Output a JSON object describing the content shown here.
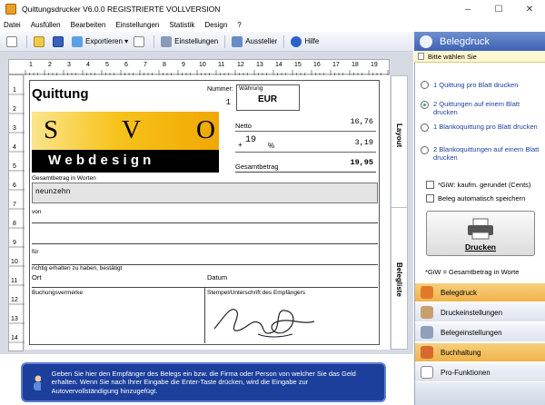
{
  "window": {
    "title": "Quittungsdrucker V6.0.0   REGISTRIERTE VOLLVERSION",
    "controls": [
      "–",
      "☐",
      "✕"
    ]
  },
  "menu": [
    "Datei",
    "Ausfüllen",
    "Bearbeiten",
    "Einstellungen",
    "Statistik",
    "Design",
    "?"
  ],
  "toolbar": {
    "export": "Exportieren ▾",
    "settings": "Einstellungen",
    "issuer": "Aussteller",
    "help": "Hilfe"
  },
  "ruler": {
    "top": [
      "1",
      "2",
      "3",
      "4",
      "5",
      "6",
      "7",
      "8",
      "9",
      "10",
      "11",
      "12",
      "13",
      "14",
      "15",
      "16",
      "17",
      "18",
      "19"
    ],
    "left": [
      "1",
      "2",
      "3",
      "4",
      "5",
      "6",
      "7",
      "8",
      "9",
      "10",
      "11",
      "12",
      "13",
      "14"
    ]
  },
  "receipt": {
    "title": "Quittung",
    "number_label": "Nummer:",
    "number_value": "1",
    "currency_label": "Währung",
    "currency_value": "EUR",
    "logo_letters": [
      "S",
      "V",
      "O"
    ],
    "logo_subtitle": "W e b d e s i g n",
    "net_label": "Netto",
    "net_value": "16,76",
    "tax_sign": "+",
    "tax_rate": "19",
    "tax_unit": "%",
    "tax_value": "3,19",
    "total_label": "Gesamtbetrag",
    "total_value": "19,95",
    "amount_words_label": "Gesamtbetrag in Worten",
    "amount_words_value": "neunzehn",
    "from_label": "von",
    "for_label": "für",
    "confirm_label": "richtig erhalten zu haben, bestätigt",
    "place_label": "Ort",
    "date_label": "Datum",
    "notes_label": "Buchungsvermerke",
    "signature_label": "Stempel/Unterschrift des Empfängers"
  },
  "side_tabs": {
    "layout": "Layout",
    "list": "Belegliste"
  },
  "infobar": {
    "text": "Geben Sie hier den Empfänger des Belegs ein bzw. die Firma oder Person von welcher Sie das Geld erhalten. Wenn Sie nach Ihrer Eingabe die Enter-Taste drücken, wird die Eingabe zur Autovervollständigung hinzugefügt."
  },
  "panel": {
    "header": "Belegdruck",
    "sub": "Bitte wählen Sie",
    "options": [
      {
        "label": "1 Quittung pro Blatt drucken",
        "selected": false
      },
      {
        "label": "2 Quittungen auf einem Blatt drucken",
        "selected": true
      },
      {
        "label": "1 Blankoquittung pro Blatt drucken",
        "selected": false
      },
      {
        "label": "2 Blankoquittungen auf einem Blatt drucken",
        "selected": false
      }
    ],
    "check_round": "*GiW: kaufm. gerundet (Cents)",
    "check_autosave": "Beleg automatisch speichern",
    "print_button": "Drucken",
    "footnote": "*GiW = Gesamtbetrag in Worte",
    "nav": [
      "Belegdruck",
      "Druckeinstellungen",
      "Belegeinstellungen",
      "Buchhaltung",
      "Pro-Funktionen"
    ]
  },
  "colors": {
    "accent": "#1c3f9c",
    "nav_active": "#f0b34a",
    "logo_yellow": "#f7c31c",
    "logo_black": "#000000"
  }
}
